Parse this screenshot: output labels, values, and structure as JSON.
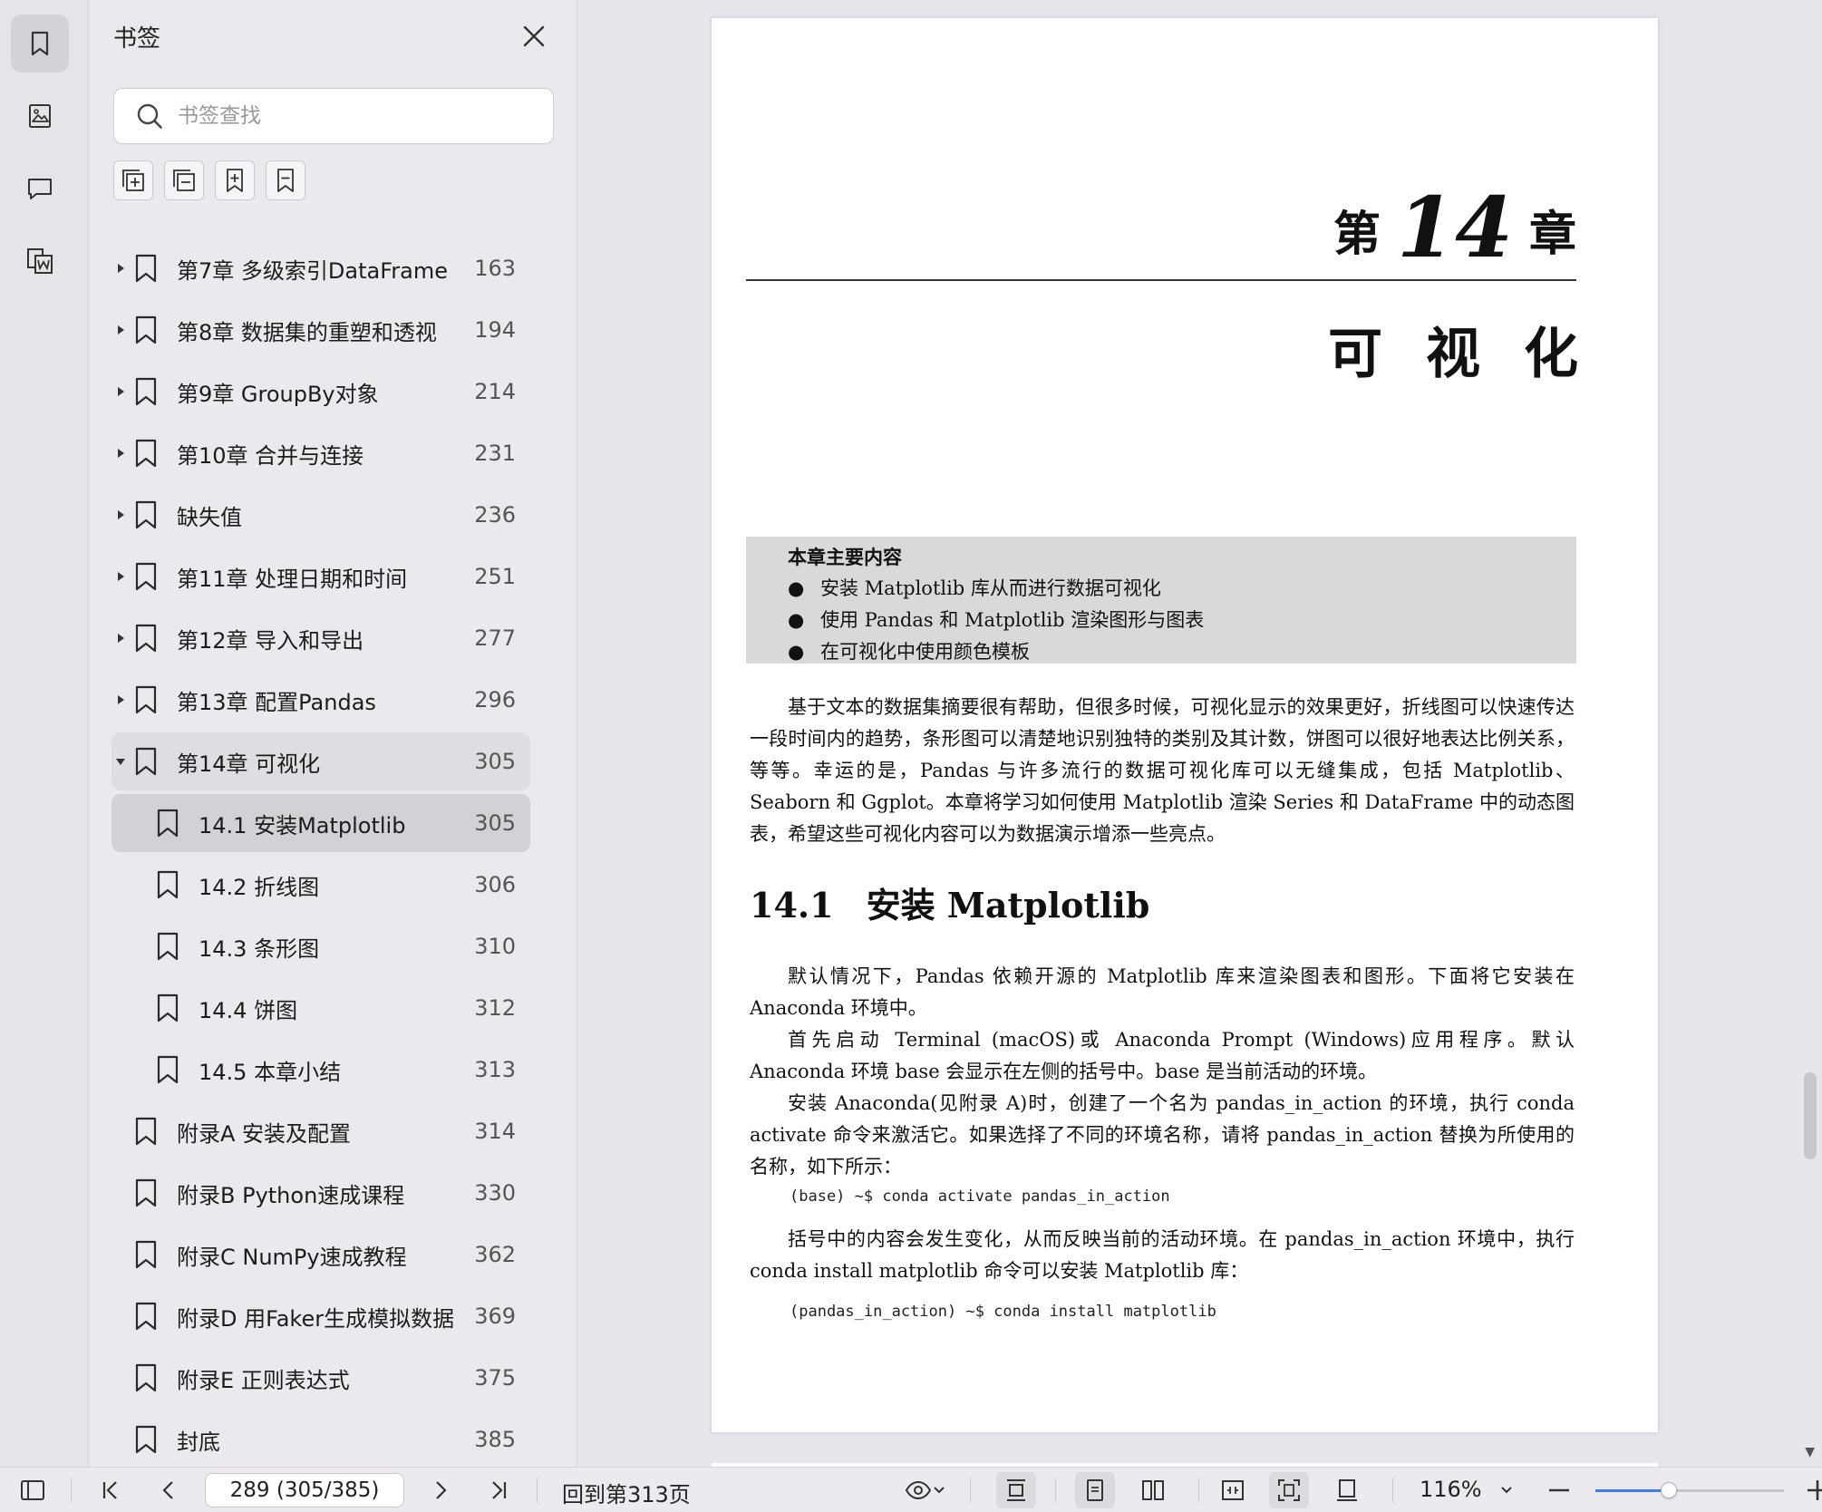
{
  "panel": {
    "title": "书签",
    "search_placeholder": "书签查找"
  },
  "bookmarks": [
    {
      "label": "第7章 多级索引DataFrame",
      "page": "163",
      "level": 1,
      "arrow": "collapsed"
    },
    {
      "label": "第8章 数据集的重塑和透视",
      "page": "194",
      "level": 1,
      "arrow": "collapsed"
    },
    {
      "label": "第9章 GroupBy对象",
      "page": "214",
      "level": 1,
      "arrow": "collapsed"
    },
    {
      "label": "第10章 合并与连接",
      "page": "231",
      "level": 1,
      "arrow": "collapsed"
    },
    {
      "label": "缺失值",
      "page": "236",
      "level": 1,
      "arrow": "collapsed"
    },
    {
      "label": "第11章 处理日期和时间",
      "page": "251",
      "level": 1,
      "arrow": "collapsed"
    },
    {
      "label": "第12章 导入和导出",
      "page": "277",
      "level": 1,
      "arrow": "collapsed"
    },
    {
      "label": "第13章 配置Pandas",
      "page": "296",
      "level": 1,
      "arrow": "collapsed"
    },
    {
      "label": "第14章 可视化",
      "page": "305",
      "level": 1,
      "arrow": "expanded"
    },
    {
      "label": "14.1 安装Matplotlib",
      "page": "305",
      "level": 2,
      "arrow": "none",
      "selected": true
    },
    {
      "label": "14.2 折线图",
      "page": "306",
      "level": 2,
      "arrow": "none"
    },
    {
      "label": "14.3 条形图",
      "page": "310",
      "level": 2,
      "arrow": "none"
    },
    {
      "label": "14.4 饼图",
      "page": "312",
      "level": 2,
      "arrow": "none"
    },
    {
      "label": "14.5 本章小结",
      "page": "313",
      "level": 2,
      "arrow": "none"
    },
    {
      "label": "附录A 安装及配置",
      "page": "314",
      "level": 1,
      "arrow": "none"
    },
    {
      "label": "附录B Python速成课程",
      "page": "330",
      "level": 1,
      "arrow": "none"
    },
    {
      "label": "附录C NumPy速成教程",
      "page": "362",
      "level": 1,
      "arrow": "none"
    },
    {
      "label": "附录D 用Faker生成模拟数据",
      "page": "369",
      "level": 1,
      "arrow": "none"
    },
    {
      "label": "附录E 正则表达式",
      "page": "375",
      "level": 1,
      "arrow": "none"
    },
    {
      "label": "封底",
      "page": "385",
      "level": 1,
      "arrow": "none"
    }
  ],
  "document": {
    "chapter_prefix": "第",
    "chapter_number": "14",
    "chapter_suffix": "章",
    "chapter_title": "可视化",
    "summary_title": "本章主要内容",
    "summary_items": [
      "安装 Matplotlib 库从而进行数据可视化",
      "使用 Pandas 和 Matplotlib 渲染图形与图表",
      "在可视化中使用颜色模板"
    ],
    "intro": "基于文本的数据集摘要很有帮助，但很多时候，可视化显示的效果更好，折线图可以快速传达一段时间内的趋势，条形图可以清楚地识别独特的类别及其计数，饼图可以很好地表达比例关系，等等。幸运的是，Pandas 与许多流行的数据可视化库可以无缝集成，包括 Matplotlib、Seaborn 和 Ggplot。本章将学习如何使用 Matplotlib 渲染 Series 和 DataFrame 中的动态图表，希望这些可视化内容可以为数据演示增添一些亮点。",
    "section_number": "14.1",
    "section_title": "安装 Matplotlib",
    "para1": "默认情况下，Pandas 依赖开源的 Matplotlib 库来渲染图表和图形。下面将它安装在 Anaconda 环境中。",
    "para2": "首先启动 Terminal (macOS)或 Anaconda Prompt (Windows)应用程序。默认 Anaconda 环境 base 会显示在左侧的括号中。base 是当前活动的环境。",
    "para3": "安装 Anaconda(见附录 A)时，创建了一个名为 pandas_in_action 的环境，执行 conda activate 命令来激活它。如果选择了不同的环境名称，请将 pandas_in_action 替换为所使用的名称，如下所示：",
    "code1": "(base) ~$ conda activate pandas_in_action",
    "para4": "括号中的内容会发生变化，从而反映当前的活动环境。在 pandas_in_action 环境中，执行 conda install matplotlib 命令可以安装 Matplotlib 库：",
    "code2": "(pandas_in_action) ~$ conda install matplotlib"
  },
  "statusbar": {
    "page_value": "289 (305/385)",
    "back_link": "回到第313页",
    "zoom": "116%",
    "zoom_fraction": 0.39
  },
  "colors": {
    "accent": "#3b7cf0",
    "selected_row": "#d3d1d6",
    "expanded_row": "#dfdde2"
  }
}
